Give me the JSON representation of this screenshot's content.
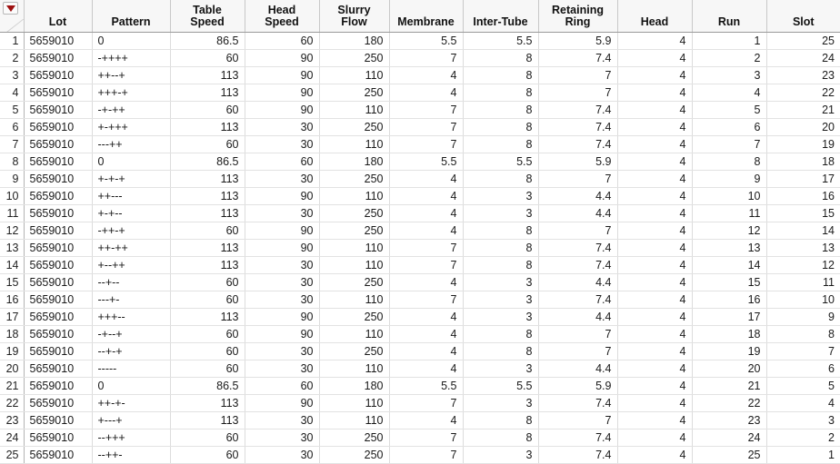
{
  "window": {
    "title": "Data Table",
    "corner_menu_icon": "red-triangle-menu-icon"
  },
  "table": {
    "columns": [
      {
        "key": "rownum",
        "label": "",
        "align": "right"
      },
      {
        "key": "lot",
        "label": "Lot",
        "align": "left"
      },
      {
        "key": "pattern",
        "label": "Pattern",
        "align": "left"
      },
      {
        "key": "table_speed",
        "label": "Table Speed",
        "align": "right"
      },
      {
        "key": "head_speed",
        "label": "Head Speed",
        "align": "right"
      },
      {
        "key": "slurry_flow",
        "label": "Slurry Flow",
        "align": "right"
      },
      {
        "key": "membrane",
        "label": "Membrane",
        "align": "right"
      },
      {
        "key": "inter_tube",
        "label": "Inter-Tube",
        "align": "right"
      },
      {
        "key": "retaining_ring",
        "label": "Retaining Ring",
        "align": "right"
      },
      {
        "key": "head",
        "label": "Head",
        "align": "right"
      },
      {
        "key": "run",
        "label": "Run",
        "align": "right"
      },
      {
        "key": "slot",
        "label": "Slot",
        "align": "right"
      }
    ],
    "row_count": 25,
    "rows": [
      {
        "rownum": "1",
        "lot": "5659010",
        "pattern": "0",
        "table_speed": "86.5",
        "head_speed": "60",
        "slurry_flow": "180",
        "membrane": "5.5",
        "inter_tube": "5.5",
        "retaining_ring": "5.9",
        "head": "4",
        "run": "1",
        "slot": "25"
      },
      {
        "rownum": "2",
        "lot": "5659010",
        "pattern": "-++++",
        "table_speed": "60",
        "head_speed": "90",
        "slurry_flow": "250",
        "membrane": "7",
        "inter_tube": "8",
        "retaining_ring": "7.4",
        "head": "4",
        "run": "2",
        "slot": "24"
      },
      {
        "rownum": "3",
        "lot": "5659010",
        "pattern": "++--+",
        "table_speed": "113",
        "head_speed": "90",
        "slurry_flow": "110",
        "membrane": "4",
        "inter_tube": "8",
        "retaining_ring": "7",
        "head": "4",
        "run": "3",
        "slot": "23"
      },
      {
        "rownum": "4",
        "lot": "5659010",
        "pattern": "+++-+",
        "table_speed": "113",
        "head_speed": "90",
        "slurry_flow": "250",
        "membrane": "4",
        "inter_tube": "8",
        "retaining_ring": "7",
        "head": "4",
        "run": "4",
        "slot": "22"
      },
      {
        "rownum": "5",
        "lot": "5659010",
        "pattern": "-+-++",
        "table_speed": "60",
        "head_speed": "90",
        "slurry_flow": "110",
        "membrane": "7",
        "inter_tube": "8",
        "retaining_ring": "7.4",
        "head": "4",
        "run": "5",
        "slot": "21"
      },
      {
        "rownum": "6",
        "lot": "5659010",
        "pattern": "+-+++",
        "table_speed": "113",
        "head_speed": "30",
        "slurry_flow": "250",
        "membrane": "7",
        "inter_tube": "8",
        "retaining_ring": "7.4",
        "head": "4",
        "run": "6",
        "slot": "20"
      },
      {
        "rownum": "7",
        "lot": "5659010",
        "pattern": "---++",
        "table_speed": "60",
        "head_speed": "30",
        "slurry_flow": "110",
        "membrane": "7",
        "inter_tube": "8",
        "retaining_ring": "7.4",
        "head": "4",
        "run": "7",
        "slot": "19"
      },
      {
        "rownum": "8",
        "lot": "5659010",
        "pattern": "0",
        "table_speed": "86.5",
        "head_speed": "60",
        "slurry_flow": "180",
        "membrane": "5.5",
        "inter_tube": "5.5",
        "retaining_ring": "5.9",
        "head": "4",
        "run": "8",
        "slot": "18"
      },
      {
        "rownum": "9",
        "lot": "5659010",
        "pattern": "+-+-+",
        "table_speed": "113",
        "head_speed": "30",
        "slurry_flow": "250",
        "membrane": "4",
        "inter_tube": "8",
        "retaining_ring": "7",
        "head": "4",
        "run": "9",
        "slot": "17"
      },
      {
        "rownum": "10",
        "lot": "5659010",
        "pattern": "++---",
        "table_speed": "113",
        "head_speed": "90",
        "slurry_flow": "110",
        "membrane": "4",
        "inter_tube": "3",
        "retaining_ring": "4.4",
        "head": "4",
        "run": "10",
        "slot": "16"
      },
      {
        "rownum": "11",
        "lot": "5659010",
        "pattern": "+-+--",
        "table_speed": "113",
        "head_speed": "30",
        "slurry_flow": "250",
        "membrane": "4",
        "inter_tube": "3",
        "retaining_ring": "4.4",
        "head": "4",
        "run": "11",
        "slot": "15"
      },
      {
        "rownum": "12",
        "lot": "5659010",
        "pattern": "-++-+",
        "table_speed": "60",
        "head_speed": "90",
        "slurry_flow": "250",
        "membrane": "4",
        "inter_tube": "8",
        "retaining_ring": "7",
        "head": "4",
        "run": "12",
        "slot": "14"
      },
      {
        "rownum": "13",
        "lot": "5659010",
        "pattern": "++-++",
        "table_speed": "113",
        "head_speed": "90",
        "slurry_flow": "110",
        "membrane": "7",
        "inter_tube": "8",
        "retaining_ring": "7.4",
        "head": "4",
        "run": "13",
        "slot": "13"
      },
      {
        "rownum": "14",
        "lot": "5659010",
        "pattern": "+--++",
        "table_speed": "113",
        "head_speed": "30",
        "slurry_flow": "110",
        "membrane": "7",
        "inter_tube": "8",
        "retaining_ring": "7.4",
        "head": "4",
        "run": "14",
        "slot": "12"
      },
      {
        "rownum": "15",
        "lot": "5659010",
        "pattern": "--+--",
        "table_speed": "60",
        "head_speed": "30",
        "slurry_flow": "250",
        "membrane": "4",
        "inter_tube": "3",
        "retaining_ring": "4.4",
        "head": "4",
        "run": "15",
        "slot": "11"
      },
      {
        "rownum": "16",
        "lot": "5659010",
        "pattern": "---+-",
        "table_speed": "60",
        "head_speed": "30",
        "slurry_flow": "110",
        "membrane": "7",
        "inter_tube": "3",
        "retaining_ring": "7.4",
        "head": "4",
        "run": "16",
        "slot": "10"
      },
      {
        "rownum": "17",
        "lot": "5659010",
        "pattern": "+++--",
        "table_speed": "113",
        "head_speed": "90",
        "slurry_flow": "250",
        "membrane": "4",
        "inter_tube": "3",
        "retaining_ring": "4.4",
        "head": "4",
        "run": "17",
        "slot": "9"
      },
      {
        "rownum": "18",
        "lot": "5659010",
        "pattern": "-+--+",
        "table_speed": "60",
        "head_speed": "90",
        "slurry_flow": "110",
        "membrane": "4",
        "inter_tube": "8",
        "retaining_ring": "7",
        "head": "4",
        "run": "18",
        "slot": "8"
      },
      {
        "rownum": "19",
        "lot": "5659010",
        "pattern": "--+-+",
        "table_speed": "60",
        "head_speed": "30",
        "slurry_flow": "250",
        "membrane": "4",
        "inter_tube": "8",
        "retaining_ring": "7",
        "head": "4",
        "run": "19",
        "slot": "7"
      },
      {
        "rownum": "20",
        "lot": "5659010",
        "pattern": "-----",
        "table_speed": "60",
        "head_speed": "30",
        "slurry_flow": "110",
        "membrane": "4",
        "inter_tube": "3",
        "retaining_ring": "4.4",
        "head": "4",
        "run": "20",
        "slot": "6"
      },
      {
        "rownum": "21",
        "lot": "5659010",
        "pattern": "0",
        "table_speed": "86.5",
        "head_speed": "60",
        "slurry_flow": "180",
        "membrane": "5.5",
        "inter_tube": "5.5",
        "retaining_ring": "5.9",
        "head": "4",
        "run": "21",
        "slot": "5"
      },
      {
        "rownum": "22",
        "lot": "5659010",
        "pattern": "++-+-",
        "table_speed": "113",
        "head_speed": "90",
        "slurry_flow": "110",
        "membrane": "7",
        "inter_tube": "3",
        "retaining_ring": "7.4",
        "head": "4",
        "run": "22",
        "slot": "4"
      },
      {
        "rownum": "23",
        "lot": "5659010",
        "pattern": "+---+",
        "table_speed": "113",
        "head_speed": "30",
        "slurry_flow": "110",
        "membrane": "4",
        "inter_tube": "8",
        "retaining_ring": "7",
        "head": "4",
        "run": "23",
        "slot": "3"
      },
      {
        "rownum": "24",
        "lot": "5659010",
        "pattern": "--+++",
        "table_speed": "60",
        "head_speed": "30",
        "slurry_flow": "250",
        "membrane": "7",
        "inter_tube": "8",
        "retaining_ring": "7.4",
        "head": "4",
        "run": "24",
        "slot": "2"
      },
      {
        "rownum": "25",
        "lot": "5659010",
        "pattern": "--++-",
        "table_speed": "60",
        "head_speed": "30",
        "slurry_flow": "250",
        "membrane": "7",
        "inter_tube": "3",
        "retaining_ring": "7.4",
        "head": "4",
        "run": "25",
        "slot": "1"
      }
    ]
  },
  "colors": {
    "header_background": "#f7f7f7",
    "grid_line": "#dcdcdc",
    "triangle_red": "#9d1010",
    "text": "#1a1a1a"
  }
}
